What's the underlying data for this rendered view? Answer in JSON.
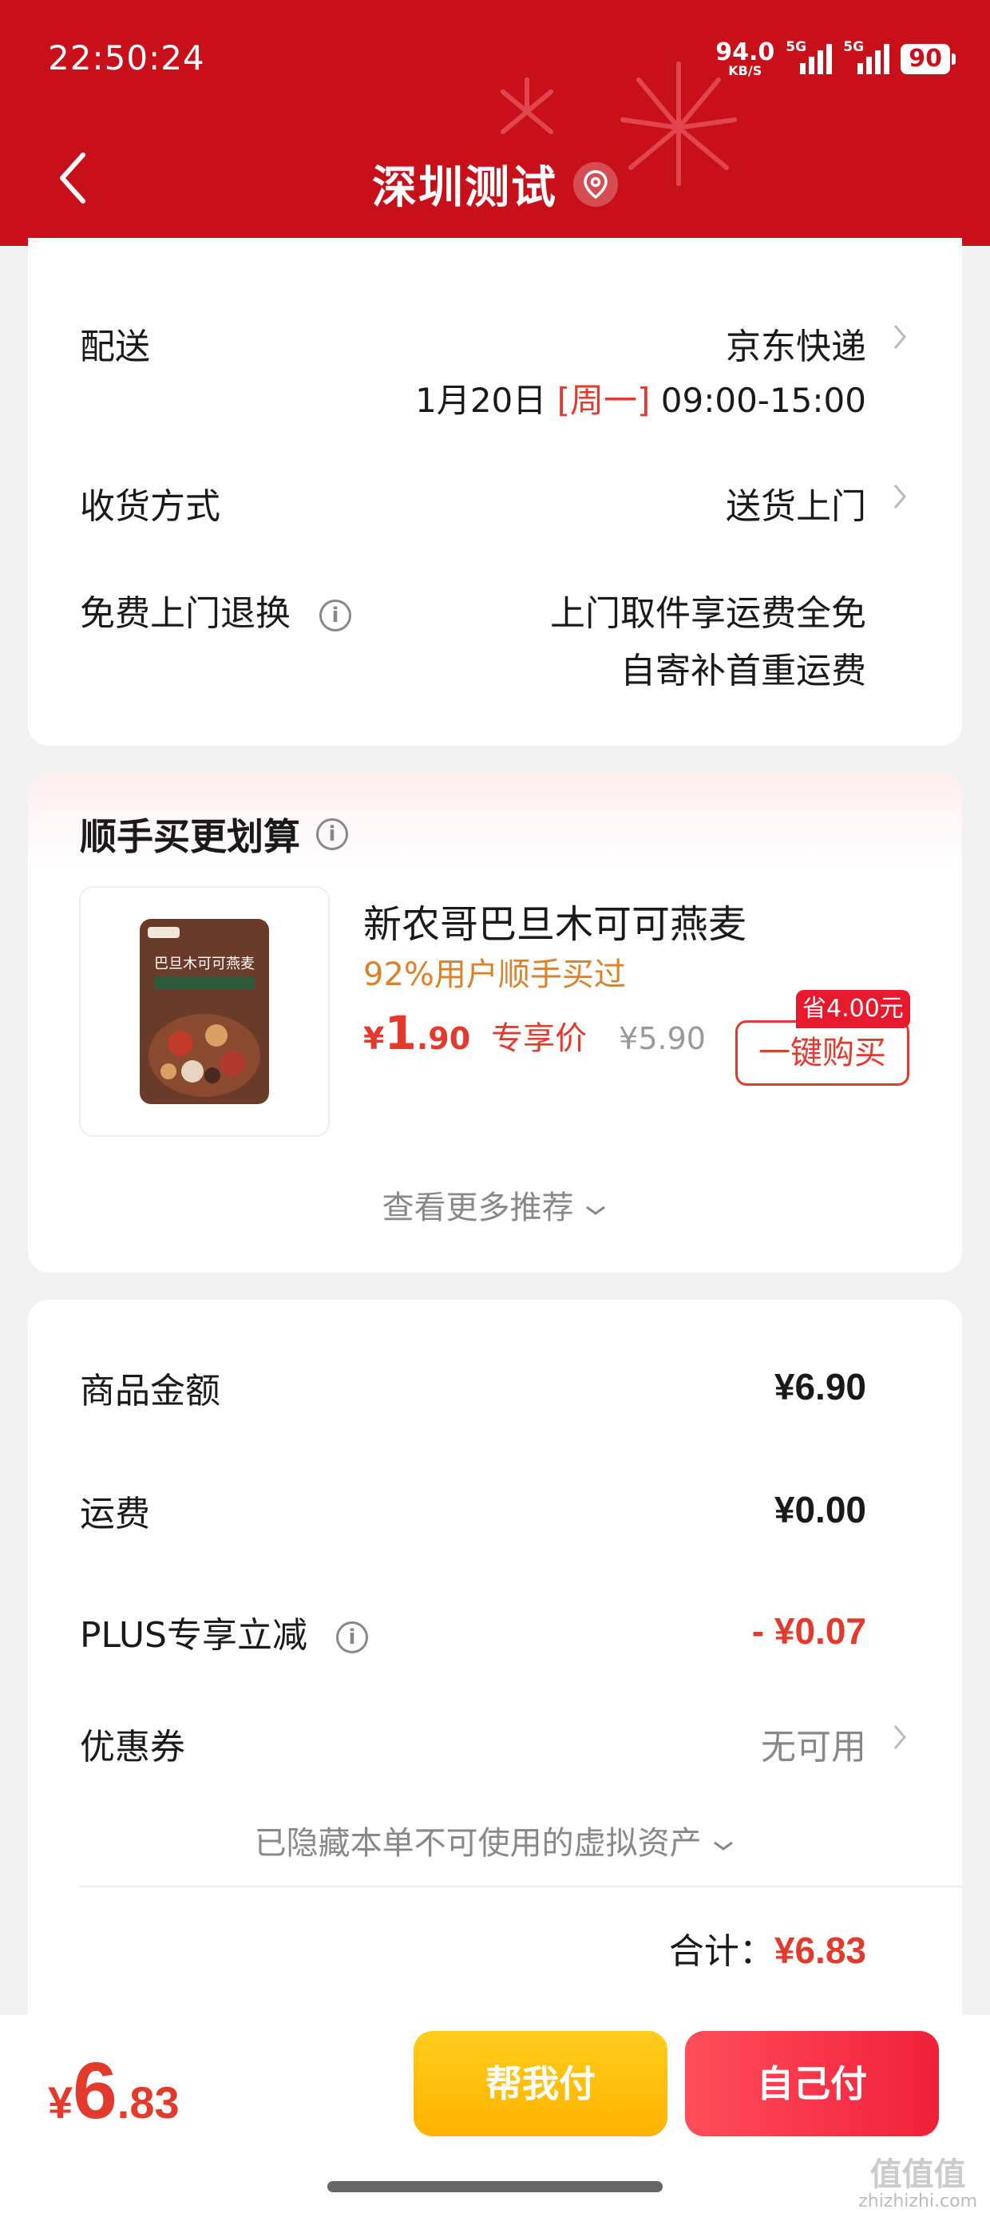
{
  "status_bar": {
    "time": "22:50:24",
    "net_speed": "94.0",
    "net_unit": "KB/S",
    "sim1": "5G",
    "sim2": "5G",
    "battery": "90"
  },
  "nav": {
    "title": "深圳测试",
    "back_icon": "back-chevron-icon",
    "location_icon": "location-pin-icon"
  },
  "delivery": {
    "shipping_label": "配送",
    "shipping_value": "京东快递",
    "date_prefix": "1月20日",
    "weekday": "[周一]",
    "time_window": "09:00-15:00",
    "receive_label": "收货方式",
    "receive_value": "送货上门",
    "return_label": "免费上门退换",
    "return_value_1": "上门取件享运费全免",
    "return_value_2": "自寄补首重运费"
  },
  "recommend": {
    "title": "顺手买更划算",
    "product_name": "新农哥巴旦木可可燕麦",
    "buy_rate": "92%用户顺手买过",
    "price_yen": "¥",
    "price_int": "1",
    "price_dec": ".90",
    "price_tag": "专享价",
    "orig_price": "¥5.90",
    "save_badge": "省4.00元",
    "buy_button": "一键购买",
    "more_label": "查看更多推荐",
    "package_text": "巴旦木可可燕麦"
  },
  "summary": {
    "goods_label": "商品金额",
    "goods_value": "¥6.90",
    "freight_label": "运费",
    "freight_value": "¥0.00",
    "plus_label": "PLUS专享立减",
    "plus_value": "- ¥0.07",
    "coupon_label": "优惠券",
    "coupon_value": "无可用",
    "hidden_note": "已隐藏本单不可使用的虚拟资产",
    "total_label": "合计：",
    "total_value": "¥6.83"
  },
  "bottom_bar": {
    "yen": "¥",
    "total_int": "6",
    "total_dec": ".83",
    "help_pay": "帮我付",
    "self_pay": "自己付"
  },
  "watermark": {
    "logo": "值值值",
    "site": "zhizhizhi.com"
  },
  "colors": {
    "header_red": "#c8101a",
    "price_red": "#e23b2e",
    "help_yellow": "#ffb300",
    "pay_red": "#f0203a"
  }
}
